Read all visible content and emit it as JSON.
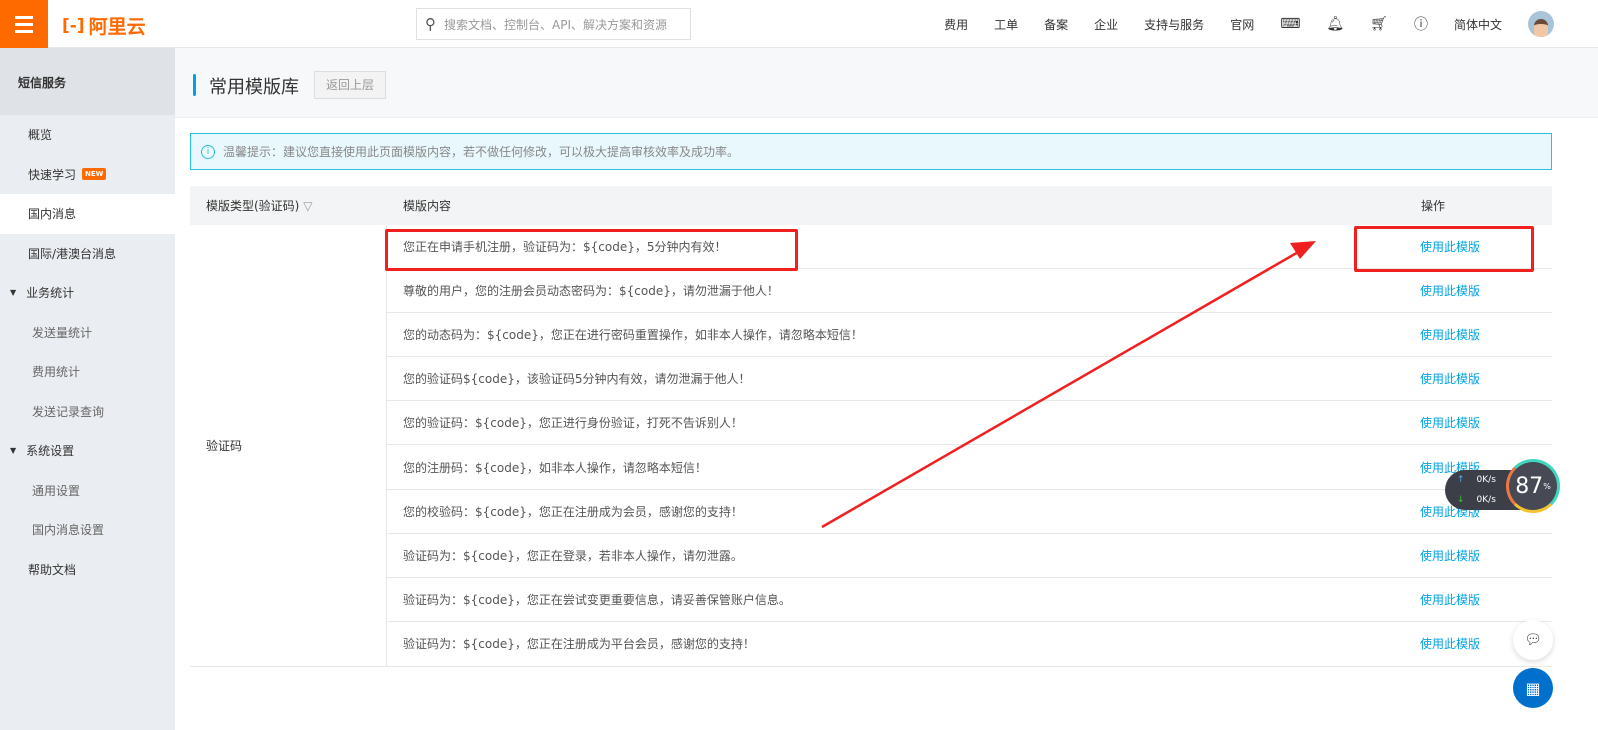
{
  "topbar": {
    "logo": "阿里云",
    "search_placeholder": "搜索文档、控制台、API、解决方案和资源",
    "nav": [
      "费用",
      "工单",
      "备案",
      "企业",
      "支持与服务",
      "官网"
    ],
    "language": "简体中文"
  },
  "sidebar": {
    "title": "短信服务",
    "items": [
      {
        "label": "概览"
      },
      {
        "label": "快速学习",
        "badge": "NEW"
      },
      {
        "label": "国内消息",
        "active": true
      },
      {
        "label": "国际/港澳台消息"
      },
      {
        "label": "业务统计",
        "group": true
      },
      {
        "label": "发送量统计"
      },
      {
        "label": "费用统计"
      },
      {
        "label": "发送记录查询"
      },
      {
        "label": "系统设置",
        "group": true
      },
      {
        "label": "通用设置"
      },
      {
        "label": "国内消息设置"
      },
      {
        "label": "帮助文档"
      }
    ]
  },
  "page": {
    "title": "常用模版库",
    "back": "返回上层",
    "tip": "温馨提示：建议您直接使用此页面模版内容，若不做任何修改，可以极大提高审核效率及成功率。"
  },
  "table": {
    "headers": [
      "模版类型(验证码)",
      "模版内容",
      "操作"
    ],
    "type": "验证码",
    "action": "使用此模版",
    "rows": [
      "您正在申请手机注册，验证码为：${code}，5分钟内有效！",
      "尊敬的用户，您的注册会员动态密码为：${code}，请勿泄漏于他人！",
      "您的动态码为：${code}，您正在进行密码重置操作，如非本人操作，请忽略本短信！",
      "您的验证码${code}，该验证码5分钟内有效，请勿泄漏于他人！",
      "您的验证码：${code}，您正进行身份验证，打死不告诉别人！",
      "您的注册码：${code}，如非本人操作，请忽略本短信！",
      "您的校验码：${code}，您正在注册成为会员，感谢您的支持！",
      "验证码为：${code}，您正在登录，若非本人操作，请勿泄露。",
      "验证码为：${code}，您正在尝试变更重要信息，请妥善保管账户信息。",
      "验证码为：${code}，您正在注册成为平台会员，感谢您的支持！"
    ]
  },
  "overlay": {
    "upload": "0K/s",
    "download": "0K/s",
    "percent": "87",
    "percent_sign": "%"
  },
  "colors": {
    "brand": "#ff6a00",
    "link": "#00a2e0",
    "annotation": "#f02020"
  }
}
